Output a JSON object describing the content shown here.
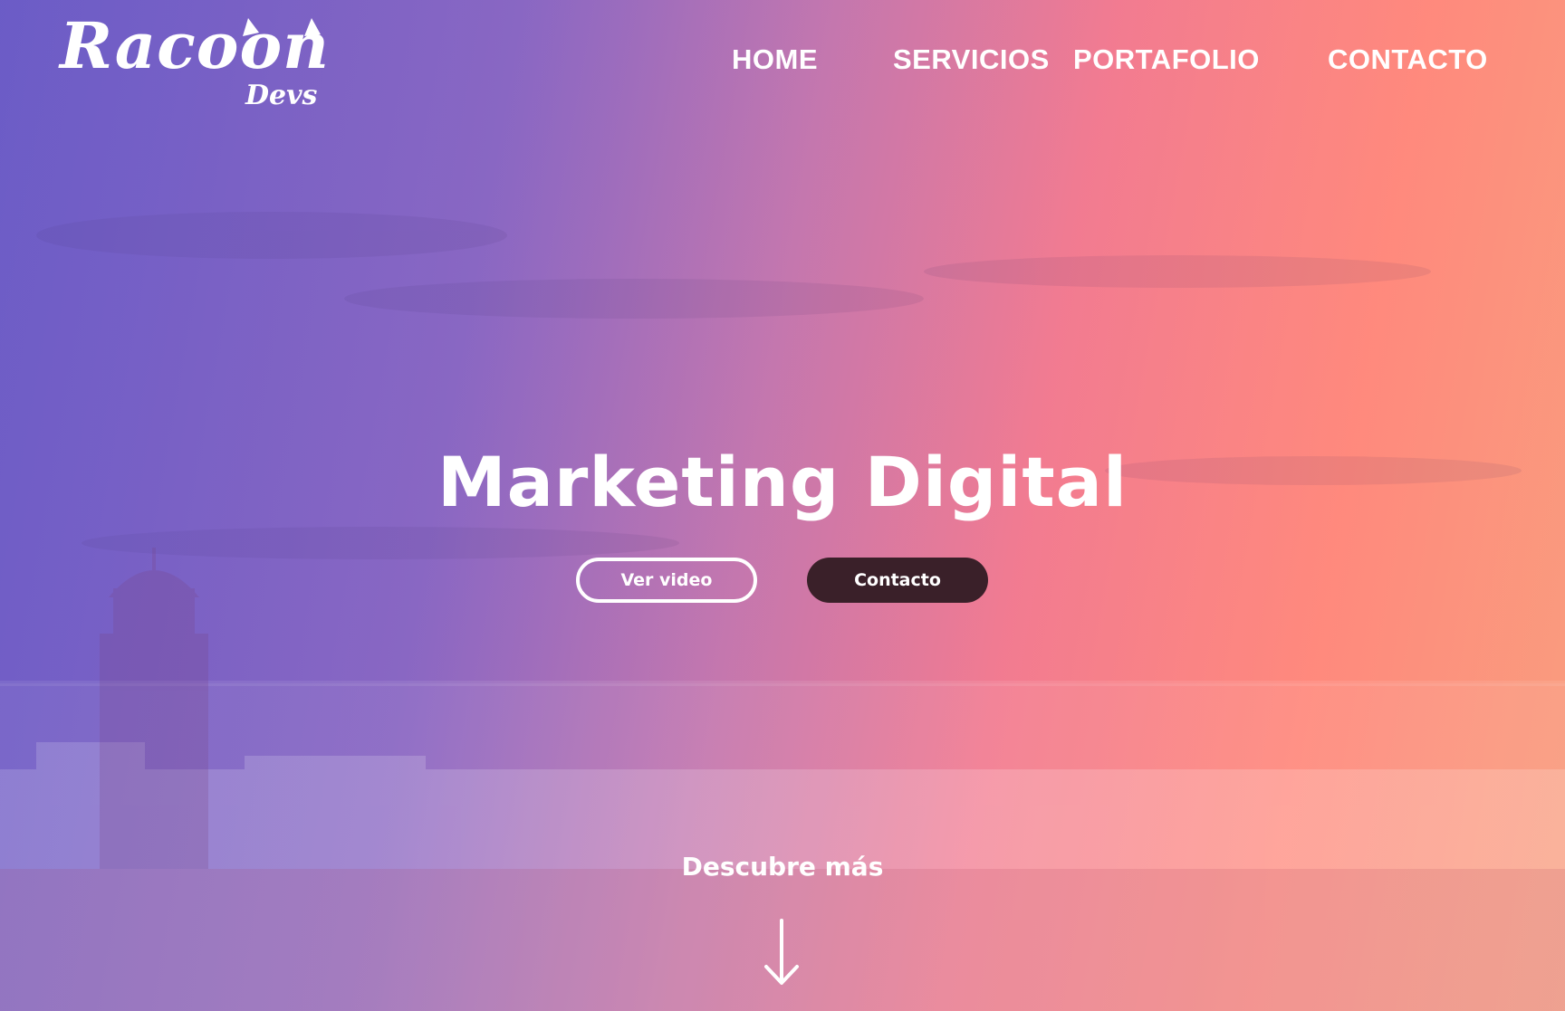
{
  "brand": {
    "name": "Racoon",
    "sub": "Devs"
  },
  "nav": {
    "home": "HOME",
    "servicios": "SERVICIOS",
    "portafolio": "PORTAFOLIO",
    "contacto": "CONTACTO"
  },
  "hero": {
    "title": "Marketing Digital",
    "primary_button": "Ver video",
    "secondary_button": "Contacto",
    "scroll_label": "Descubre más"
  },
  "colors": {
    "gradient_left": "#6b5cc6",
    "gradient_right": "#ff8a7d",
    "contact_button": "#3a2029"
  },
  "icons": {
    "scroll": "arrow-down-icon"
  }
}
